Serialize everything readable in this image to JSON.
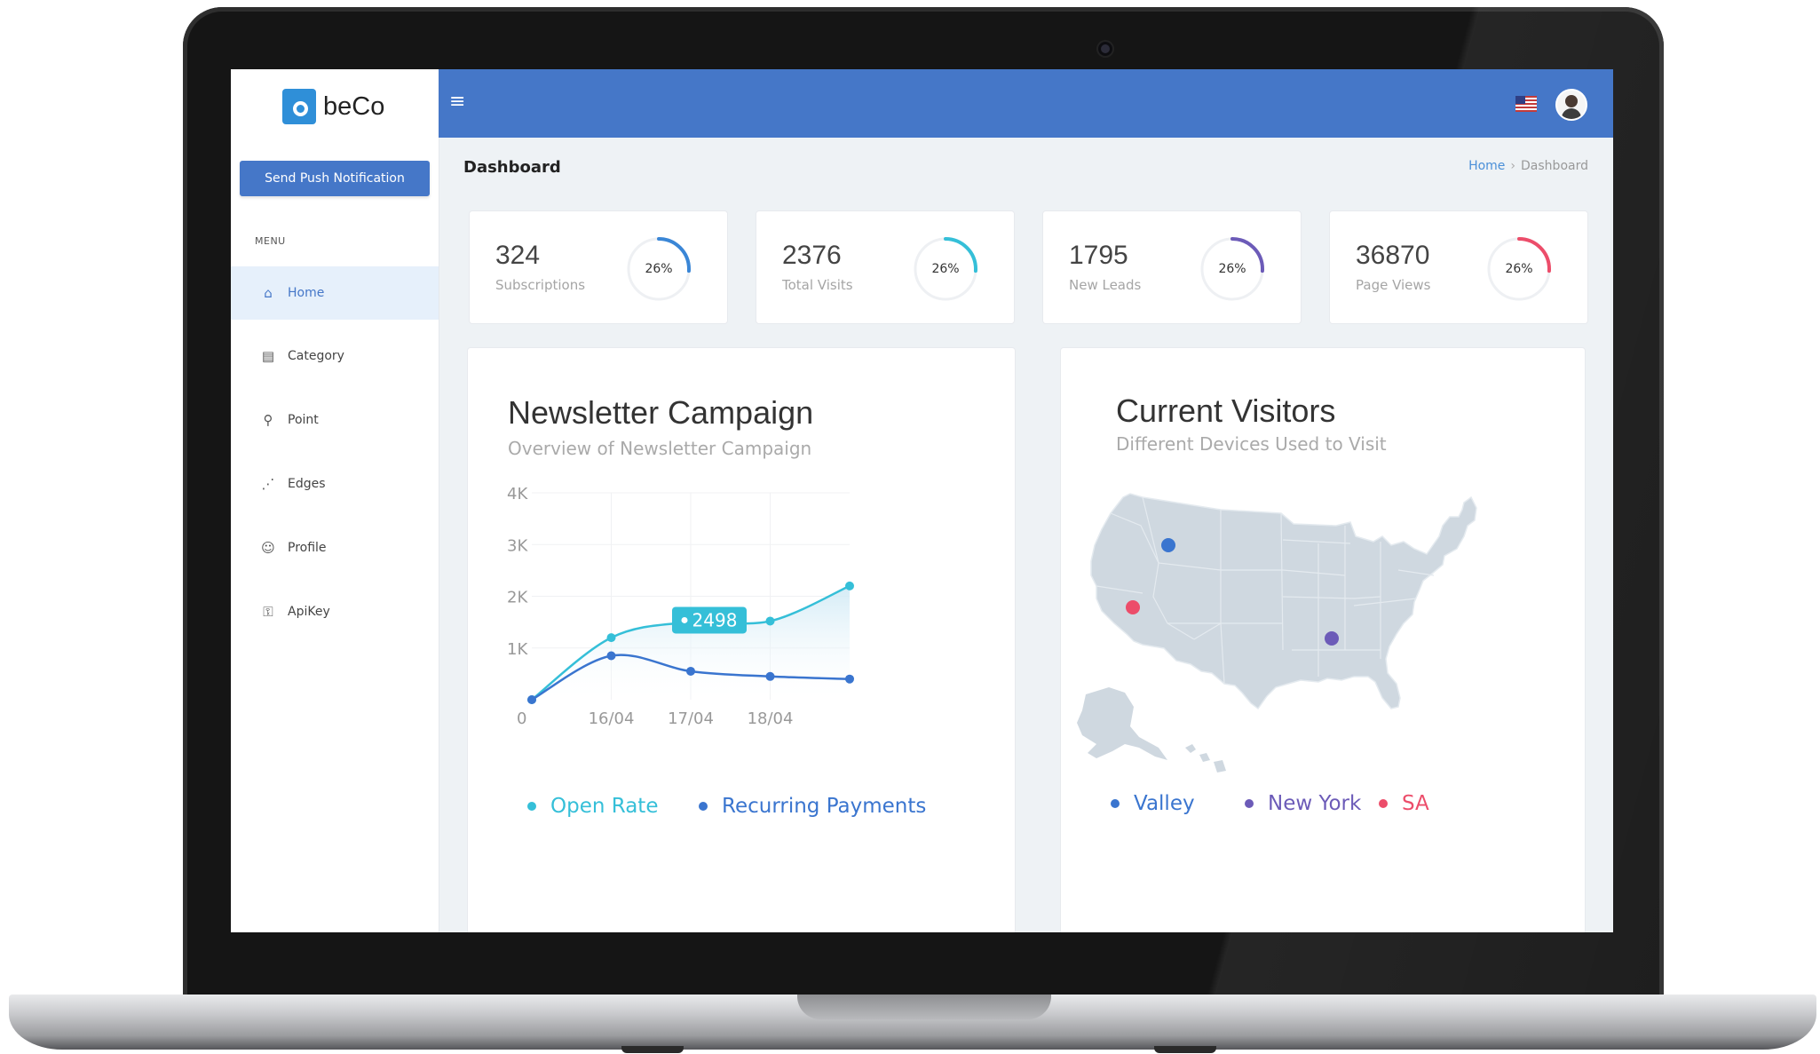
{
  "app": {
    "logo_text": "beCo"
  },
  "sidebar": {
    "push_button": "Send Push Notification",
    "menu_title": "MENU",
    "items": [
      {
        "label": "Home",
        "icon": "home-icon",
        "active": true
      },
      {
        "label": "Category",
        "icon": "document-icon"
      },
      {
        "label": "Point",
        "icon": "map-pin-icon"
      },
      {
        "label": "Edges",
        "icon": "graph-edges-icon"
      },
      {
        "label": "Profile",
        "icon": "user-icon"
      },
      {
        "label": "ApiKey",
        "icon": "users-key-icon"
      }
    ]
  },
  "topbar": {
    "menu_icon": "hamburger-icon",
    "flag_icon": "us-flag-icon",
    "avatar": "user-avatar"
  },
  "header": {
    "title": "Dashboard",
    "breadcrumb": [
      "Home",
      "Dashboard"
    ]
  },
  "stats": [
    {
      "value": "324",
      "label": "Subscriptions",
      "percent": "26%",
      "fraction": 0.26,
      "color": "#3a86d6"
    },
    {
      "value": "2376",
      "label": "Total Visits",
      "percent": "26%",
      "fraction": 0.26,
      "color": "#35bfd8"
    },
    {
      "value": "1795",
      "label": "New Leads",
      "percent": "26%",
      "fraction": 0.26,
      "color": "#6c5bb8"
    },
    {
      "value": "36870",
      "label": "Page Views",
      "percent": "26%",
      "fraction": 0.26,
      "color": "#ec4d6a"
    }
  ],
  "newsletter": {
    "title": "Newsletter Campaign",
    "subtitle": "Overview of Newsletter Campaign",
    "tooltip": "2498"
  },
  "chart_data": {
    "type": "line",
    "title": "Newsletter Campaign",
    "subtitle": "Overview of Newsletter Campaign",
    "ylim": [
      0,
      4000
    ],
    "y_ticks": [
      "0",
      "1K",
      "2K",
      "3K",
      "4K"
    ],
    "x_tick_labels": [
      "16/04",
      "17/04",
      "18/04"
    ],
    "x_positions": [
      0,
      1,
      2,
      3,
      4
    ],
    "x_tick_positions": [
      1,
      2,
      3
    ],
    "series": [
      {
        "name": "Open Rate",
        "color": "#35bfd8",
        "values": [
          0,
          1200,
          1500,
          1520,
          2200
        ]
      },
      {
        "name": "Recurring Payments",
        "color": "#3a75cf",
        "values": [
          0,
          850,
          550,
          450,
          400
        ]
      }
    ],
    "legend": "bottom",
    "grid": true
  },
  "visitors": {
    "title": "Current Visitors",
    "subtitle": "Different Devices Used to Visit",
    "legend": [
      {
        "name": "Valley",
        "color": "#3a75cf"
      },
      {
        "name": "New York",
        "color": "#6c5bb8"
      },
      {
        "name": "SA",
        "color": "#ec4d6a"
      }
    ]
  }
}
